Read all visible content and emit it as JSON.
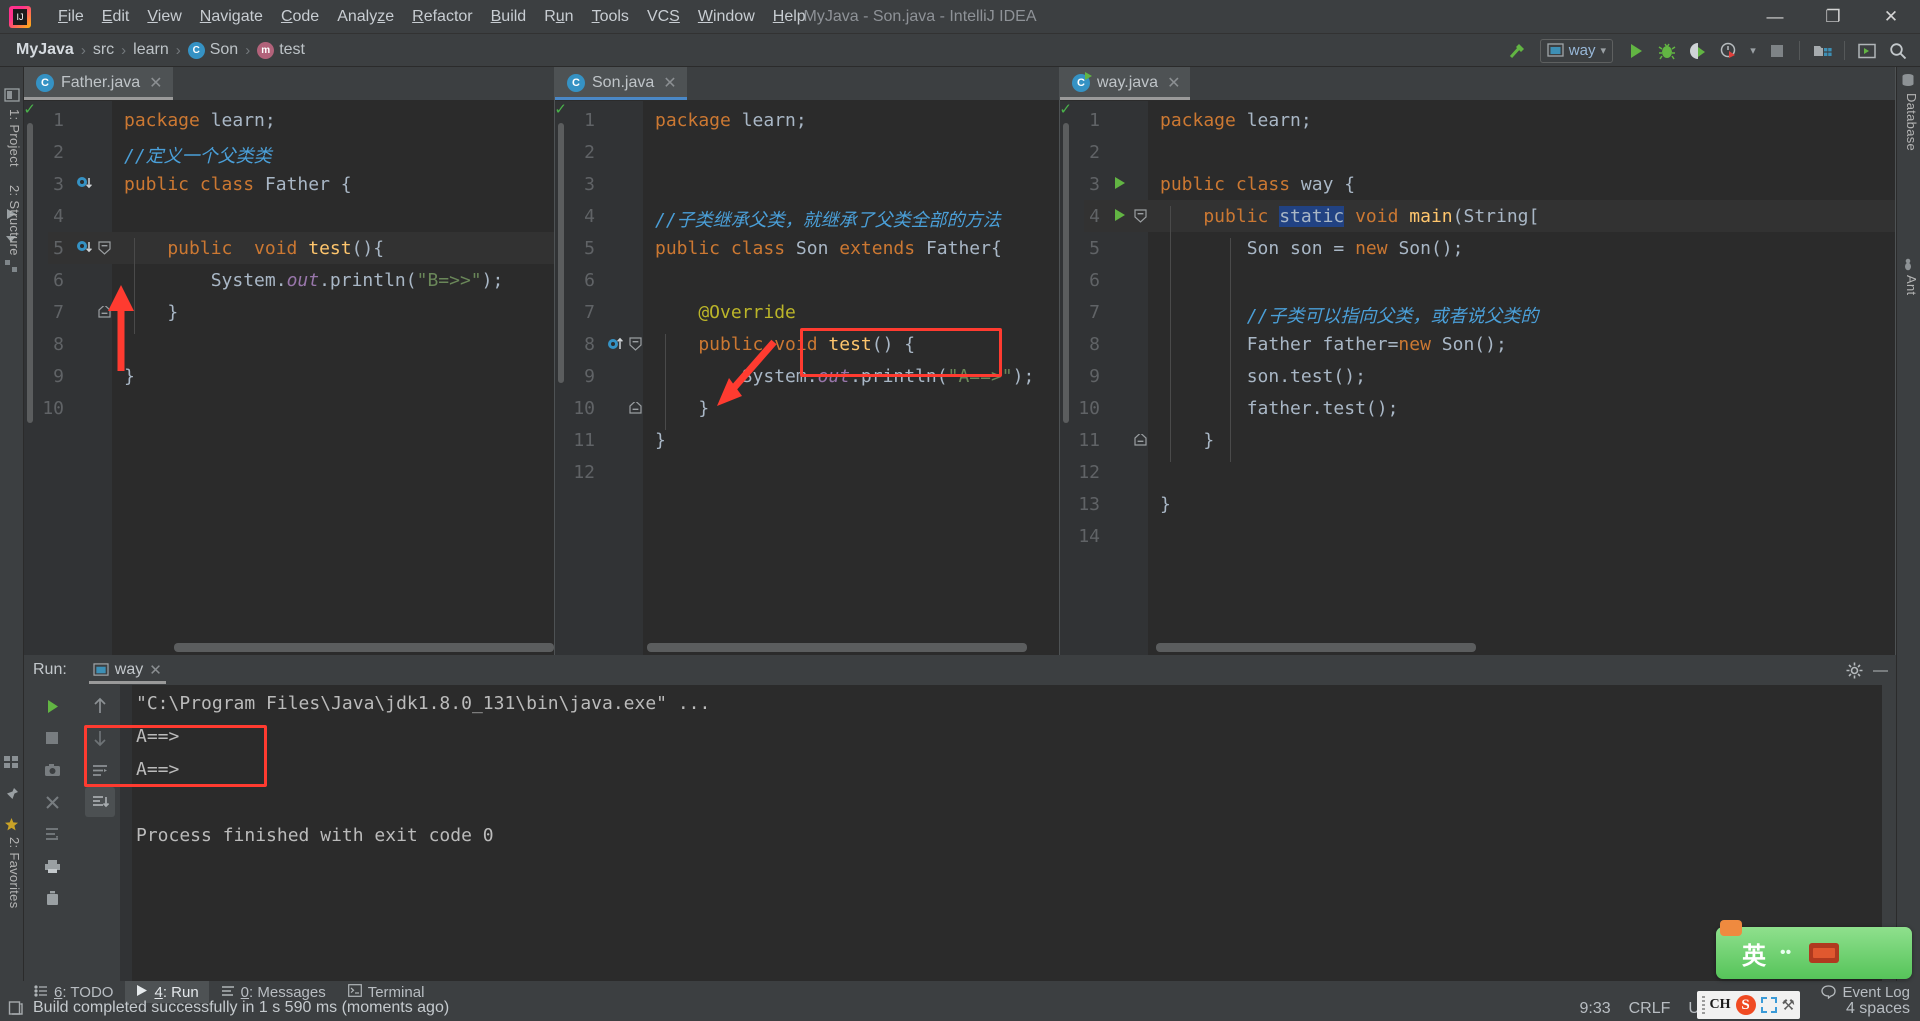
{
  "window": {
    "title": "MyJava - Son.java - IntelliJ IDEA",
    "logo_text": "IJ",
    "minimize": "—",
    "maximize": "❐",
    "close": "✕"
  },
  "menu": [
    {
      "label": "File",
      "mnemonic": "F"
    },
    {
      "label": "Edit",
      "mnemonic": "E"
    },
    {
      "label": "View",
      "mnemonic": "V"
    },
    {
      "label": "Navigate",
      "mnemonic": "N"
    },
    {
      "label": "Code",
      "mnemonic": "C"
    },
    {
      "label": "Analyze",
      "mnemonic": "z"
    },
    {
      "label": "Refactor",
      "mnemonic": "R"
    },
    {
      "label": "Build",
      "mnemonic": "B"
    },
    {
      "label": "Run",
      "mnemonic": "u"
    },
    {
      "label": "Tools",
      "mnemonic": "T"
    },
    {
      "label": "VCS",
      "mnemonic": "S"
    },
    {
      "label": "Window",
      "mnemonic": "W"
    },
    {
      "label": "Help",
      "mnemonic": "H"
    }
  ],
  "breadcrumb": {
    "items": [
      {
        "label": "MyJava",
        "icon": "",
        "root": true
      },
      {
        "label": "src",
        "icon": ""
      },
      {
        "label": "learn",
        "icon": ""
      },
      {
        "label": "Son",
        "icon": "class-icon",
        "badge": "C"
      },
      {
        "label": "test",
        "icon": "method-icon",
        "badge": "m"
      }
    ],
    "separator": "›"
  },
  "toolbar": {
    "build_icon": "hammer-icon",
    "run_config": {
      "label": "way",
      "icon": "run-config-icon",
      "chevron": "▾"
    },
    "run_button": "run-icon",
    "debug_button": "debug-icon",
    "run_coverage_button": "run-with-coverage-icon",
    "profiler_button": "profiler-icon",
    "profiler_chevron": "▾",
    "stop_button": "stop-icon",
    "project_structure_button": "project-structure-icon",
    "terminal_button": "terminal-icon",
    "search_button": "search-everywhere-icon"
  },
  "left_strip": {
    "tabs": [
      {
        "label": "1: Project",
        "icon": "project-icon"
      },
      {
        "label": "2: Structure",
        "icon": "structure-icon"
      },
      {
        "label": "2: Favorites",
        "icon": "favorites-icon"
      }
    ],
    "icons": [
      "project-tree-icon",
      "run-triangle-icon",
      "chevron-down-icon",
      "module-icon",
      "bookmark-icon",
      "star-icon"
    ]
  },
  "right_strip": {
    "tabs": [
      {
        "label": "Database",
        "icon": "database-icon"
      },
      {
        "label": "Ant",
        "icon": "ant-icon"
      }
    ]
  },
  "editor": {
    "panes": [
      {
        "tab": {
          "label": "Father.java",
          "icon": "java-class-icon",
          "badge": "C",
          "state": "unselected",
          "close": "✕"
        },
        "lines": [
          {
            "n": 1,
            "tokens": [
              {
                "t": "package",
                "c": "kw"
              },
              {
                "t": " learn",
                "c": "txt"
              },
              {
                "t": ";",
                "c": "txt"
              }
            ]
          },
          {
            "n": 2,
            "tokens": [
              {
                "t": "//定义一个父类类",
                "c": "cmt-cn"
              }
            ]
          },
          {
            "n": 3,
            "tokens": [
              {
                "t": "public class ",
                "c": "kw"
              },
              {
                "t": "Father {",
                "c": "txt"
              }
            ],
            "gutter": "overridden-method-icon"
          },
          {
            "n": 4,
            "tokens": []
          },
          {
            "n": 5,
            "tokens": [
              {
                "t": "    public  void ",
                "c": "kw"
              },
              {
                "t": "test",
                "c": "mth"
              },
              {
                "t": "(){",
                "c": "txt"
              }
            ],
            "gutter": "overridden-method-icon",
            "fold": "collapse-icon",
            "current": true
          },
          {
            "n": 6,
            "tokens": [
              {
                "t": "        System.",
                "c": "txt"
              },
              {
                "t": "out",
                "c": "fld"
              },
              {
                "t": ".println(",
                "c": "txt"
              },
              {
                "t": "\"B=>>\"",
                "c": "str"
              },
              {
                "t": ");",
                "c": "txt"
              }
            ]
          },
          {
            "n": 7,
            "tokens": [
              {
                "t": "    }",
                "c": "txt"
              }
            ],
            "fold": "collapse-end-icon"
          },
          {
            "n": 8,
            "tokens": []
          },
          {
            "n": 9,
            "tokens": [
              {
                "t": "}",
                "c": "txt"
              }
            ]
          },
          {
            "n": 10,
            "tokens": []
          }
        ],
        "inspection_status": "ok-check-icon"
      },
      {
        "tab": {
          "label": "Son.java",
          "icon": "java-class-icon",
          "badge": "C",
          "state": "selected",
          "close": "✕"
        },
        "lines": [
          {
            "n": 1,
            "tokens": [
              {
                "t": "package",
                "c": "kw"
              },
              {
                "t": " learn",
                "c": "txt"
              },
              {
                "t": ";",
                "c": "txt"
              }
            ]
          },
          {
            "n": 2,
            "tokens": []
          },
          {
            "n": 3,
            "tokens": []
          },
          {
            "n": 4,
            "tokens": [
              {
                "t": "//子类继承父类，就继承了父类全部的方法",
                "c": "cmt-cn"
              }
            ]
          },
          {
            "n": 5,
            "tokens": [
              {
                "t": "public class ",
                "c": "kw"
              },
              {
                "t": "Son ",
                "c": "txt"
              },
              {
                "t": "extends ",
                "c": "kw"
              },
              {
                "t": "Father{",
                "c": "txt"
              }
            ]
          },
          {
            "n": 6,
            "tokens": []
          },
          {
            "n": 7,
            "tokens": [
              {
                "t": "    @Override",
                "c": "anno"
              }
            ]
          },
          {
            "n": 8,
            "tokens": [
              {
                "t": "    public void ",
                "c": "kw"
              },
              {
                "t": "test",
                "c": "mth"
              },
              {
                "t": "() {",
                "c": "txt"
              }
            ],
            "gutter": "overriding-method-icon",
            "fold": "collapse-icon"
          },
          {
            "n": 9,
            "tokens": [
              {
                "t": "        System.",
                "c": "txt"
              },
              {
                "t": "out",
                "c": "fld"
              },
              {
                "t": ".println(",
                "c": "txt"
              },
              {
                "t": "\"A==>\"",
                "c": "str"
              },
              {
                "t": ");",
                "c": "txt"
              }
            ]
          },
          {
            "n": 10,
            "tokens": [
              {
                "t": "    }",
                "c": "txt"
              }
            ],
            "fold": "collapse-end-icon"
          },
          {
            "n": 11,
            "tokens": [
              {
                "t": "}",
                "c": "txt"
              }
            ]
          },
          {
            "n": 12,
            "tokens": []
          }
        ],
        "inspection_status": "ok-check-icon"
      },
      {
        "tab": {
          "label": "way.java",
          "icon": "java-runnable-class-icon",
          "badge": "C",
          "state": "unselected",
          "close": "✕"
        },
        "lines": [
          {
            "n": 1,
            "tokens": [
              {
                "t": "package",
                "c": "kw"
              },
              {
                "t": " learn",
                "c": "txt"
              },
              {
                "t": ";",
                "c": "txt"
              }
            ]
          },
          {
            "n": 2,
            "tokens": []
          },
          {
            "n": 3,
            "tokens": [
              {
                "t": "public class ",
                "c": "kw"
              },
              {
                "t": "way {",
                "c": "txt"
              }
            ],
            "gutter": "run-method-icon"
          },
          {
            "n": 4,
            "tokens": [
              {
                "t": "    public ",
                "c": "kw"
              },
              {
                "t": "static",
                "c": "sel-tok"
              },
              {
                "t": " void ",
                "c": "kw"
              },
              {
                "t": "main",
                "c": "mth"
              },
              {
                "t": "(String[",
                "c": "txt"
              }
            ],
            "gutter": "run-method-icon",
            "fold": "collapse-icon",
            "current": true
          },
          {
            "n": 5,
            "tokens": [
              {
                "t": "        Son son = ",
                "c": "txt"
              },
              {
                "t": "new ",
                "c": "kw"
              },
              {
                "t": "Son();",
                "c": "txt"
              }
            ]
          },
          {
            "n": 6,
            "tokens": []
          },
          {
            "n": 7,
            "tokens": [
              {
                "t": "        //子类可以指向父类，或者说父类的",
                "c": "cmt-cn"
              }
            ]
          },
          {
            "n": 8,
            "tokens": [
              {
                "t": "        Father father=",
                "c": "txt"
              },
              {
                "t": "new ",
                "c": "kw"
              },
              {
                "t": "Son();",
                "c": "txt"
              }
            ]
          },
          {
            "n": 9,
            "tokens": [
              {
                "t": "        son.test();",
                "c": "txt"
              }
            ]
          },
          {
            "n": 10,
            "tokens": [
              {
                "t": "        father.test();",
                "c": "txt"
              }
            ]
          },
          {
            "n": 11,
            "tokens": [
              {
                "t": "    }",
                "c": "txt"
              }
            ],
            "fold": "collapse-end-icon"
          },
          {
            "n": 12,
            "tokens": []
          },
          {
            "n": 13,
            "tokens": [
              {
                "t": "}",
                "c": "txt"
              }
            ]
          },
          {
            "n": 14,
            "tokens": []
          }
        ],
        "inspection_status": "ok-check-icon"
      }
    ]
  },
  "annotations": {
    "override_box_target": "@Override",
    "console_box_target": "A==> / A==>",
    "arrow_father_target": "overridden-method-gutter-icon",
    "arrow_son_target": "overriding-method-gutter-icon"
  },
  "run_panel": {
    "label": "Run:",
    "tab": {
      "label": "way",
      "icon": "run-config-icon",
      "close": "✕"
    },
    "gear_icon": "settings-icon",
    "minimize_icon": "—",
    "actions_left": [
      "rerun-icon",
      "stop-icon",
      "screenshot-icon",
      "close-icon",
      "layout-icon",
      "print-icon",
      "trash-icon"
    ],
    "actions_right": [
      "scroll-up-icon",
      "scroll-down-icon",
      "soft-wrap-icon",
      "scroll-to-end-icon"
    ],
    "console": [
      "\"C:\\Program Files\\Java\\jdk1.8.0_131\\bin\\java.exe\" ...",
      "A==>",
      "A==>",
      "",
      "Process finished with exit code 0"
    ]
  },
  "statusbar": {
    "tabs": [
      {
        "label": "6: TODO",
        "mnemonic": "6",
        "icon": "todo-icon",
        "active": false
      },
      {
        "label": "4: Run",
        "mnemonic": "4",
        "icon": "run-icon",
        "active": true
      },
      {
        "label": "0: Messages",
        "mnemonic": "0",
        "icon": "messages-icon",
        "active": false
      },
      {
        "label": "Terminal",
        "mnemonic": "",
        "icon": "terminal-icon",
        "active": false
      }
    ],
    "message": "Build completed successfully in 1 s 590 ms (moments ago)",
    "message_icon": "build-icon",
    "event_log": "Event Log",
    "event_log_icon": "balloon-icon",
    "caret_position": "9:33",
    "line_separator": "CRLF",
    "encoding": "U",
    "indent": "4 spaces"
  },
  "ime": {
    "mode_label": "英",
    "dots": "••",
    "keyboard_icon": "keyboard-icon",
    "sogou": {
      "ck": "CH",
      "logo": "S",
      "fullwidth_icon": "fullwidth-icon",
      "hat_icon": "toolbox-icon"
    }
  },
  "colors": {
    "accent_blue": "#4a88c7",
    "run_green": "#62b543",
    "annotation_red": "#ff3b30",
    "keyword_orange": "#cc7832",
    "string_green": "#6a8759",
    "comment_blue": "#4a9fd8",
    "anno_yellow": "#bbb529",
    "editor_bg": "#2b2b2b",
    "chrome_bg": "#3c3f41"
  }
}
